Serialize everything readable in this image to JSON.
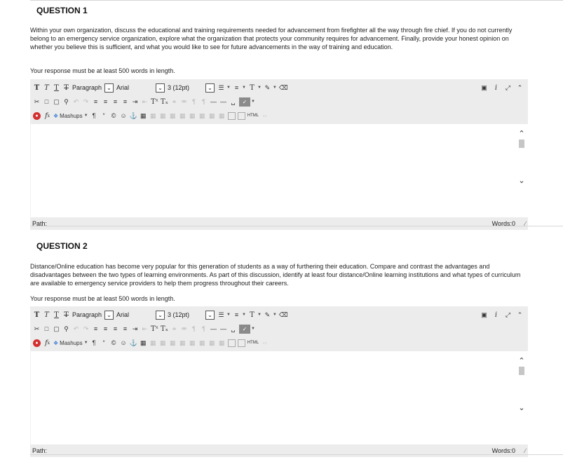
{
  "questions": [
    {
      "title": "QUESTION 1",
      "body": "Within your own organization, discuss the educational and training requirements needed for advancement from firefighter all the way through fire chief. If you do not currently belong to an emergency service organization, explore what the organization that protects your community requires for advancement. Finally, provide your honest opinion on whether you believe this is sufficient, and what you would like to see for future advancements in the way of training and education.",
      "requirement": "Your response must be at least 500 words in length.",
      "editor": {
        "paragraph_label": "Paragraph",
        "font_label": "Arial",
        "size_label": "3 (12pt)",
        "mashups_label": "Mashups",
        "html_label": "HTML",
        "path_label": "Path:",
        "words_label": "Words:0"
      }
    },
    {
      "title": "QUESTION 2",
      "body": "Distance/Online education has become very popular for this generation of students as a way of furthering their education. Compare and contrast the advantages and disadvantages between the two types of learning environments. As part of this discussion, identify at least four distance/Online learning institutions and what types of curriculum are available to emergency service providers to help them progress throughout their careers.",
      "requirement": "Your response must be at least 500 words in length.",
      "editor": {
        "paragraph_label": "Paragraph",
        "font_label": "Arial",
        "size_label": "3 (12pt)",
        "mashups_label": "Mashups",
        "html_label": "HTML",
        "path_label": "Path:",
        "words_label": "Words:0"
      }
    }
  ]
}
